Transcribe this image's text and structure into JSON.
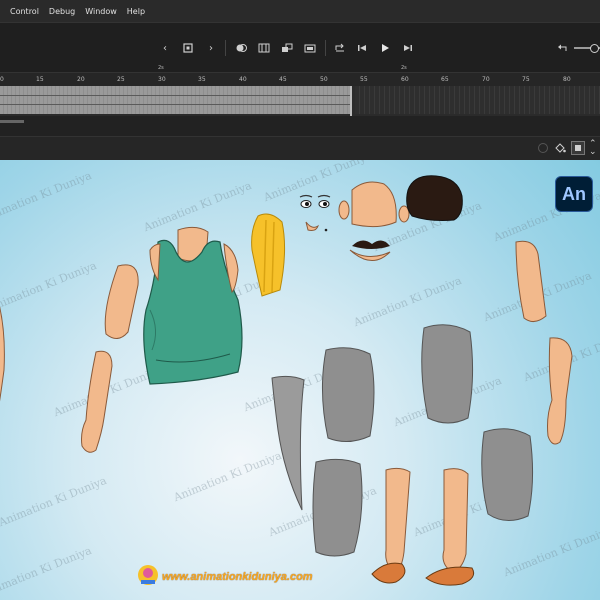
{
  "menu": {
    "items": [
      "Control",
      "Debug",
      "Window",
      "Help"
    ]
  },
  "timeline": {
    "ruler_ticks": [
      "0",
      "15",
      "20",
      "25",
      "30",
      "35",
      "40",
      "45",
      "50",
      "55",
      "60",
      "65",
      "70",
      "75",
      "80"
    ],
    "second_markers": [
      "2s",
      "2s"
    ]
  },
  "stage": {
    "watermark_text": "Animation Ki Duniya",
    "app_logo": "An",
    "site_url": "www.animationkiduniya.com"
  },
  "colors": {
    "skin": "#f2b98c",
    "vest": "#3fa187",
    "cloth": "#8f8f8f",
    "accent": "#f5a623"
  }
}
